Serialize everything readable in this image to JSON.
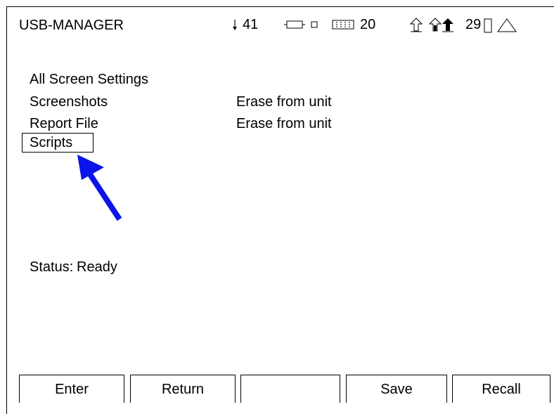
{
  "header": {
    "title": "USB-MANAGER",
    "status_num_1": "41",
    "status_num_2": "20",
    "status_num_3": "29",
    "icons": [
      "down-arrow-icon",
      "cable-icon",
      "small-square-icon",
      "battery-icon",
      "up-arrow-outline-icon",
      "up-arrow-house-icon",
      "up-arrow-filled-icon",
      "tall-rect-icon",
      "triangle-icon"
    ]
  },
  "menu": {
    "items": [
      {
        "label": "All Screen Settings",
        "action": ""
      },
      {
        "label": "Screenshots",
        "action": "Erase from unit"
      },
      {
        "label": "Report File",
        "action": "Erase from unit"
      },
      {
        "label": "Scripts",
        "action": ""
      }
    ],
    "selected_index": 3
  },
  "status": {
    "label": "Status:",
    "value": "Ready"
  },
  "softkeys": [
    "Enter",
    "Return",
    "",
    "Save",
    "Recall"
  ],
  "colors": {
    "annotation_arrow": "#0a14e8"
  }
}
